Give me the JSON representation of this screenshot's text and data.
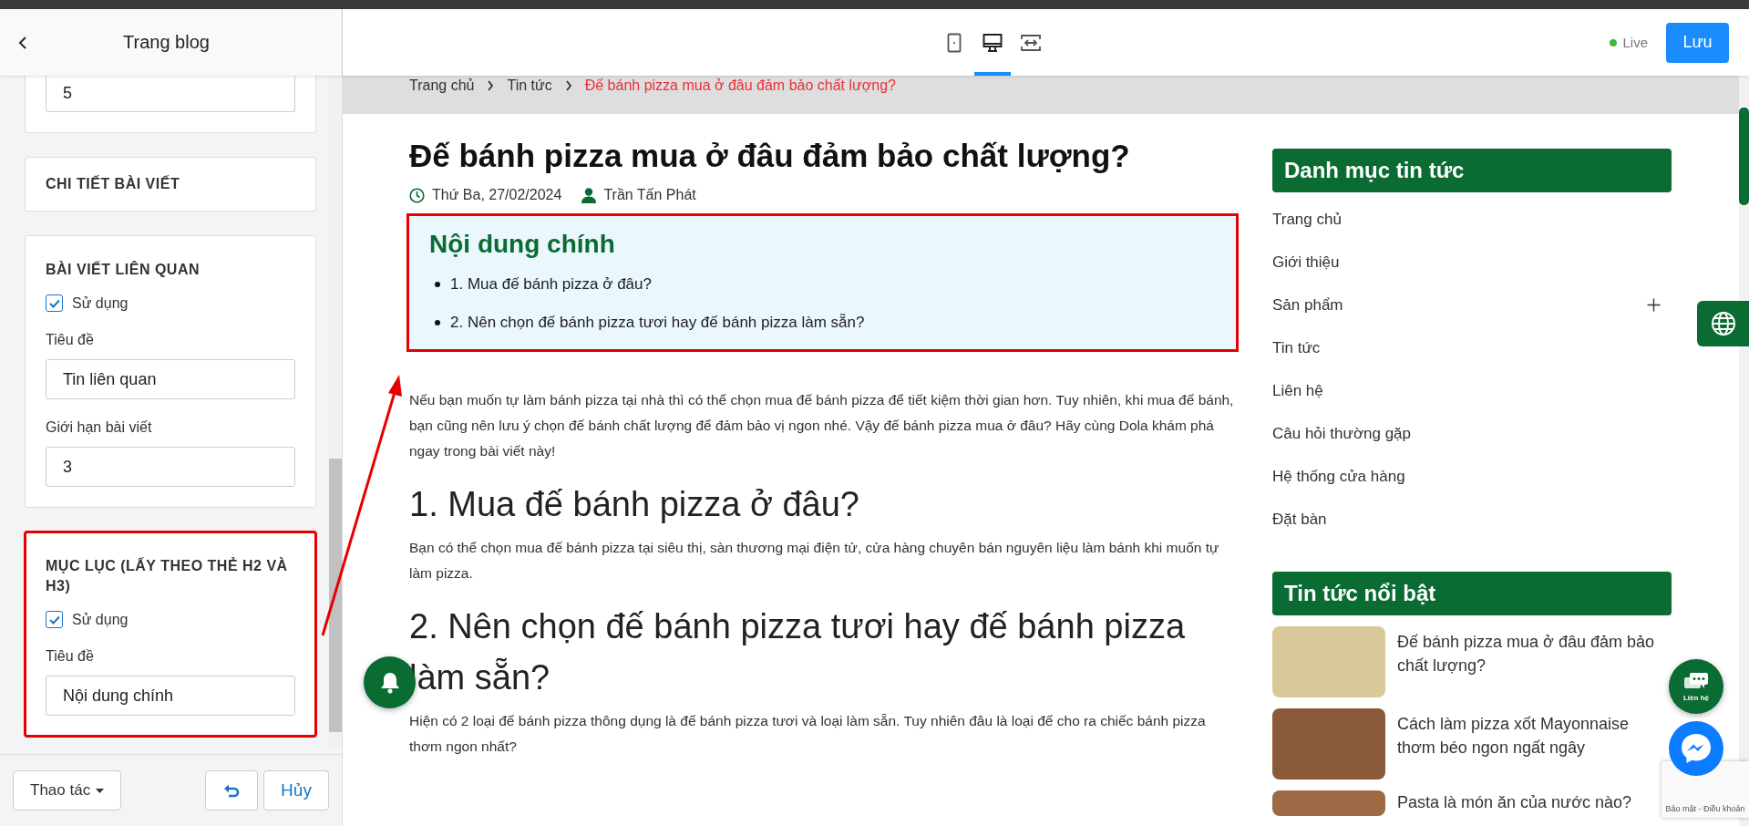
{
  "editor": {
    "title": "Trang blog",
    "sections": [
      {
        "kind": "input",
        "value": "5"
      },
      {
        "kind": "heading",
        "title": "CHI TIẾT BÀI VIẾT"
      },
      {
        "kind": "group",
        "title": "BÀI VIẾT LIÊN QUAN",
        "annotated": false,
        "fields": [
          {
            "kind": "checkbox",
            "label": "Sử dụng",
            "checked": true
          },
          {
            "kind": "text",
            "label": "Tiêu đề",
            "value": "Tin liên quan"
          },
          {
            "kind": "text",
            "label": "Giới hạn bài viết",
            "value": "3"
          }
        ]
      },
      {
        "kind": "group",
        "title": "MỤC LỤC (LẤY THEO THẺ H2 VÀ H3)",
        "annotated": true,
        "fields": [
          {
            "kind": "checkbox",
            "label": "Sử dụng",
            "checked": true
          },
          {
            "kind": "text",
            "label": "Tiêu đề",
            "value": "Nội dung chính"
          }
        ]
      }
    ],
    "footer": {
      "actions": "Thao tác",
      "cancel": "Hủy"
    }
  },
  "toolbar": {
    "devices": [
      {
        "kind": "tablet",
        "selected": false
      },
      {
        "kind": "desktop",
        "selected": true
      },
      {
        "kind": "fullwidth",
        "selected": false
      }
    ],
    "status": "Live",
    "save": "Lưu"
  },
  "preview": {
    "breadcrumb": [
      {
        "label": "Trang chủ",
        "current": false
      },
      {
        "label": "Tin tức",
        "current": false
      },
      {
        "label": "Đế bánh pizza mua ở đâu đảm bảo chất lượng?",
        "current": true
      }
    ],
    "article": {
      "title": "Đế bánh pizza mua ở đâu đảm bảo chất lượng?",
      "date": "Thứ Ba, 27/02/2024",
      "author": "Trần Tấn Phát",
      "toc": {
        "title": "Nội dung chính",
        "annotated": true,
        "items": [
          "1. Mua đế bánh pizza ở đâu?",
          "2. Nên chọn đế bánh pizza tươi hay đế bánh pizza làm sẵn?"
        ]
      },
      "intro": "Nếu bạn muốn tự làm bánh pizza tại nhà thì có thể chọn mua đế bánh pizza để tiết kiệm thời gian hơn. Tuy nhiên, khi mua đế bánh, bạn cũng nên lưu ý chọn đế bánh chất lượng để đảm bảo vị ngon nhé. Vậy đế bánh pizza mua ở đâu? Hãy cùng Dola khám phá ngay trong bài viết này!",
      "sections": [
        {
          "heading": "1. Mua đế bánh pizza ở đâu?",
          "body": "Bạn có thể chọn mua đế bánh pizza tại siêu thị, sàn thương mại điện tử, cửa hàng chuyên bán nguyên liệu làm bánh khi muốn tự làm pizza."
        },
        {
          "heading": "2. Nên chọn đế bánh pizza tươi hay đế bánh pizza làm sẵn?",
          "body": "Hiện có 2 loại đế bánh pizza thông dụng là đế bánh pizza tươi và loại làm sẵn. Tuy nhiên đâu là loại đế cho ra chiếc bánh pizza thơm ngon nhất?"
        }
      ]
    },
    "sidebar": {
      "categories": {
        "title": "Danh mục tin tức",
        "items": [
          {
            "label": "Trang chủ",
            "expandable": false
          },
          {
            "label": "Giới thiệu",
            "expandable": false
          },
          {
            "label": "Sản phẩm",
            "expandable": true
          },
          {
            "label": "Tin tức",
            "expandable": false
          },
          {
            "label": "Liên hệ",
            "expandable": false
          },
          {
            "label": "Câu hỏi thường gặp",
            "expandable": false
          },
          {
            "label": "Hệ thống cửa hàng",
            "expandable": false
          },
          {
            "label": "Đặt bàn",
            "expandable": false
          }
        ]
      },
      "featured": {
        "title": "Tin tức nổi bật",
        "items": [
          {
            "title": "Đế bánh pizza mua ở đâu đảm bảo chất lượng?"
          },
          {
            "title": "Cách làm pizza xốt Mayonnaise thơm béo ngon ngất ngây"
          },
          {
            "title": "Pasta là món ăn của nước nào?"
          }
        ]
      }
    },
    "widgets": {
      "contact": "Liên hệ",
      "recaptcha": "Bảo mật - Điều khoản"
    }
  }
}
